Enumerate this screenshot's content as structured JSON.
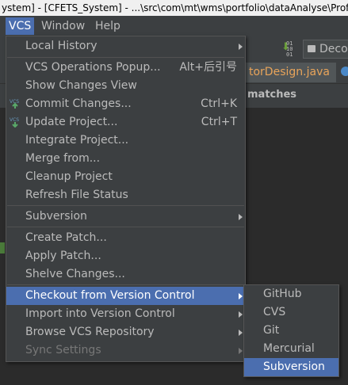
{
  "window": {
    "title": "ystem] - [CFETS_System] - ...\\src\\com\\mt\\wms\\portfolio\\dataAnalyse\\ProfitLoss"
  },
  "menubar": {
    "vcs": "VCS",
    "window": "Window",
    "help": "Help"
  },
  "toolbar": {
    "config_label": "Decor",
    "config_icon": "config-box-icon"
  },
  "tabs": {
    "active_tab": "torDesign.java"
  },
  "search": {
    "matches": "matches"
  },
  "menu": {
    "items": [
      {
        "label": "Local History",
        "shortcut": "",
        "submenu": true
      },
      {
        "label": "VCS Operations Popup...",
        "shortcut": "Alt+后引号",
        "submenu": false
      },
      {
        "label": "Show Changes View",
        "shortcut": "",
        "submenu": false
      },
      {
        "label": "Commit Changes...",
        "shortcut": "Ctrl+K",
        "submenu": false,
        "icon": "commit-icon"
      },
      {
        "label": "Update Project...",
        "shortcut": "Ctrl+T",
        "submenu": false,
        "icon": "update-icon"
      },
      {
        "label": "Integrate Project...",
        "shortcut": "",
        "submenu": false
      },
      {
        "label": "Merge from...",
        "shortcut": "",
        "submenu": false
      },
      {
        "label": "Cleanup Project",
        "shortcut": "",
        "submenu": false
      },
      {
        "label": "Refresh File Status",
        "shortcut": "",
        "submenu": false
      },
      {
        "label": "Subversion",
        "shortcut": "",
        "submenu": true
      },
      {
        "label": "Create Patch...",
        "shortcut": "",
        "submenu": false
      },
      {
        "label": "Apply Patch...",
        "shortcut": "",
        "submenu": false
      },
      {
        "label": "Shelve Changes...",
        "shortcut": "",
        "submenu": false
      },
      {
        "label": "Checkout from Version Control",
        "shortcut": "",
        "submenu": true,
        "highlighted": true
      },
      {
        "label": "Import into Version Control",
        "shortcut": "",
        "submenu": true
      },
      {
        "label": "Browse VCS Repository",
        "shortcut": "",
        "submenu": true
      },
      {
        "label": "Sync Settings",
        "shortcut": "",
        "submenu": true,
        "disabled": true
      }
    ]
  },
  "submenu": {
    "items": [
      {
        "label": "GitHub"
      },
      {
        "label": "CVS"
      },
      {
        "label": "Git"
      },
      {
        "label": "Mercurial"
      },
      {
        "label": "Subversion",
        "highlighted": true
      }
    ]
  },
  "colors": {
    "menu_bg": "#3c3f41",
    "highlight": "#4b6eaf",
    "text": "#bbbbbb",
    "disabled_text": "#777777",
    "tab_text": "#e8a45a"
  }
}
